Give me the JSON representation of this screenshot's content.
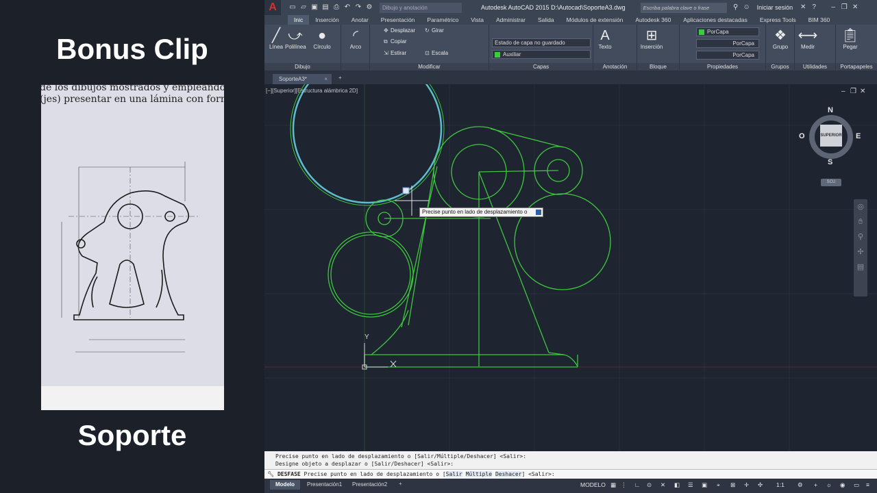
{
  "left": {
    "heading": "Bonus Clip",
    "caption": "Soporte",
    "paper_lines": [
      "de los dibujos mostrados y empleando",
      "(jes) presentar en una lámina con forma"
    ]
  },
  "qat": {
    "workspace": "Dibujo y anotación",
    "title": "Autodesk AutoCAD 2015   D:\\Autocad\\SoporteA3.dwg",
    "search_placeholder": "Escriba palabra clave o frase",
    "login": "Iniciar sesión"
  },
  "ribbon_tabs": [
    "Inic",
    "Inserción",
    "Anotar",
    "Presentación",
    "Paramétrico",
    "Vista",
    "Administrar",
    "Salida",
    "Módulos de extensión",
    "Autodesk 360",
    "Aplicaciones destacadas",
    "Express Tools",
    "BIM 360"
  ],
  "ribbon": {
    "dibujo": {
      "label": "Dibujo",
      "tools": [
        "Línea",
        "Polilínea",
        "Círculo",
        "Arco"
      ]
    },
    "modificar": {
      "label": "Modificar",
      "tools": [
        "Desplazar",
        "Girar",
        "Copiar",
        "Estirar",
        "Escala"
      ]
    },
    "capas": {
      "label": "Capas",
      "state": "Estado de capa no guardado",
      "layer": "Auxiliar"
    },
    "anotacion": {
      "label": "Anotación",
      "tool": "Texto"
    },
    "bloque": {
      "label": "Bloque",
      "tool": "Inserción"
    },
    "propiedades": {
      "label": "Propiedades",
      "color": "PorCapa",
      "linetype": "PorCapa",
      "lineweight": "PorCapa"
    },
    "grupos": {
      "label": "Grupos",
      "tool": "Grupo"
    },
    "utilidades": {
      "label": "Utilidades",
      "tool": "Medir"
    },
    "portapapeles": {
      "label": "Portapapeles",
      "tool": "Pegar"
    }
  },
  "document_tab": "SoporteA3*",
  "viewport_label": "[−][Superior][Estructura alámbrica 2D]",
  "tooltip": "Precise punto en lado de desplazamiento o",
  "viewcube": {
    "n": "N",
    "s": "S",
    "e": "E",
    "w": "O",
    "face": "SUPERIOR",
    "ucs": "SCU"
  },
  "ucs_icon": {
    "y": "Y"
  },
  "command": {
    "history": [
      "Precise punto en lado de desplazamiento o [Salir/Múltiple/Deshacer] <Salir>:",
      "Designe objeto a desplazar o [Salir/Deshacer] <Salir>:"
    ],
    "command_name": "DESFASE",
    "prompt": "Precise punto en lado de desplazamiento o",
    "options": [
      "Salir",
      "Múltiple",
      "Deshacer"
    ],
    "default": "<Salir>:"
  },
  "status": {
    "layouts": [
      "Modelo",
      "Presentación1",
      "Presentación2"
    ],
    "mode": "MODELO",
    "scale": "1:1"
  },
  "colors": {
    "geometry": "#3ec83e",
    "selected": "#6ad8e8",
    "background": "#1e2430"
  }
}
